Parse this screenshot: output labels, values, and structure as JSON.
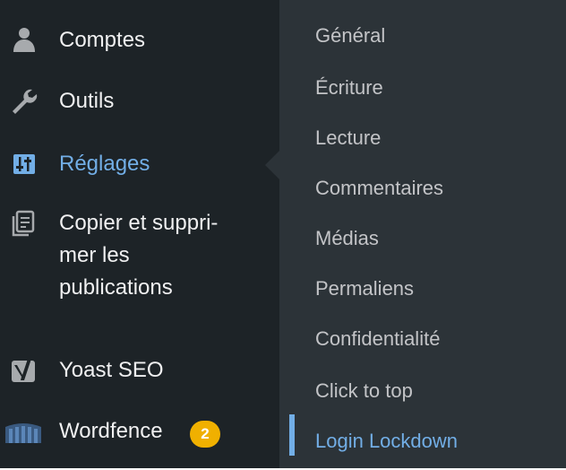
{
  "sidebar": {
    "items": [
      {
        "label": "Comptes",
        "icon": "user-icon"
      },
      {
        "label": "Outils",
        "icon": "wrench-icon"
      },
      {
        "label": "Réglages",
        "icon": "settings-sliders-icon",
        "current": true
      },
      {
        "label_lines": [
          "Copier et suppri-",
          "mer les",
          "publications"
        ],
        "icon": "copy-delete-icon"
      },
      {
        "label": "Yoast SEO",
        "icon": "yoast-icon"
      },
      {
        "label": "Wordfence",
        "icon": "wordfence-icon",
        "badge": "2"
      }
    ]
  },
  "submenu": {
    "items": [
      {
        "label": "Général"
      },
      {
        "label": "Écriture"
      },
      {
        "label": "Lecture"
      },
      {
        "label": "Commentaires"
      },
      {
        "label": "Médias"
      },
      {
        "label": "Permaliens"
      },
      {
        "label": "Confidentialité"
      },
      {
        "label": "Click to top"
      },
      {
        "label": "Login Lockdown",
        "active": true
      }
    ]
  },
  "colors": {
    "sidebar_bg": "#1d2327",
    "submenu_bg": "#2c3338",
    "text": "#f0f0f1",
    "submenu_text": "#c3c4c7",
    "accent": "#72aee6",
    "badge": "#f0b000"
  }
}
